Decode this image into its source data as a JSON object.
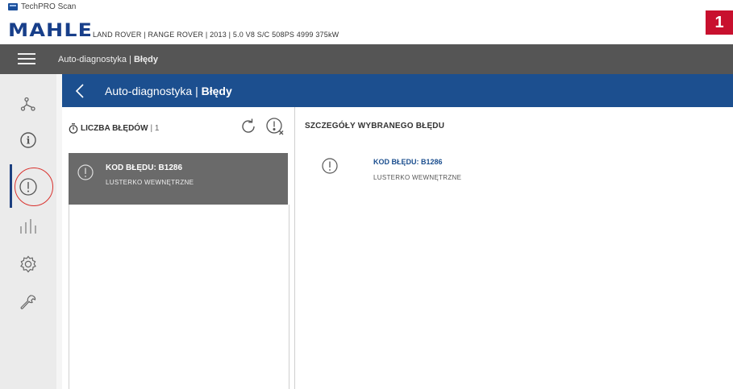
{
  "app": {
    "title": "TechPRO Scan",
    "brand": "MAHLE",
    "vehicle_info": "LAND ROVER | RANGE ROVER | 2013 | 5.0 V8 S/C 508PS 4999 375kW",
    "badge_number": "1"
  },
  "top_nav": {
    "section": "Auto-diagnostyka |",
    "page": "Błędy"
  },
  "nav": {
    "section": "Auto-diagnostyka |",
    "page": "Błędy"
  },
  "sidebar": {
    "items": [
      {
        "icon": "connection-icon",
        "label": "connection"
      },
      {
        "icon": "info-icon",
        "label": "info"
      },
      {
        "icon": "fault-icon",
        "label": "faults",
        "active": true
      },
      {
        "icon": "chart-icon",
        "label": "live data"
      },
      {
        "icon": "gear-icon",
        "label": "settings"
      },
      {
        "icon": "wrench-icon",
        "label": "service"
      }
    ]
  },
  "fault_list": {
    "header_label": "LICZBA BŁĘDÓW",
    "count": "| 1",
    "items": [
      {
        "code": "KOD BŁĘDU: B1286",
        "description": "LUSTERKO WEWNĘTRZNE"
      }
    ]
  },
  "details": {
    "title": "SZCZEGÓŁY WYBRANEGO BŁĘDU",
    "code": "KOD BŁĘDU: B1286",
    "description": "LUSTERKO WEWNĘTRZNE"
  },
  "colors": {
    "brand_blue": "#183f8a",
    "nav_blue": "#1c4f8f",
    "dark_bar": "#555555",
    "selected_item": "#6a6a6a",
    "badge_red": "#c8102e"
  }
}
